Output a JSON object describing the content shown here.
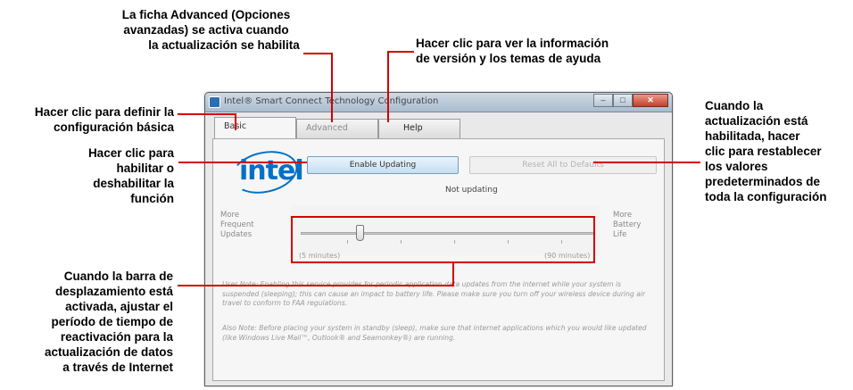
{
  "annotations": {
    "advanced_tab": [
      "La ficha Advanced (Opciones",
      "avanzadas) se activa cuando",
      "la actualización se habilita"
    ],
    "help_tab": [
      "Hacer clic para ver la información",
      "de versión y los temas de ayuda"
    ],
    "basic_tab": [
      "Hacer clic para definir la",
      "configuración básica"
    ],
    "enable_button": [
      "Hacer clic para",
      "habilitar o",
      "deshabilitar la",
      "función"
    ],
    "reset_button": [
      "Cuando la",
      "actualización está",
      "habilitada, hacer",
      "clic para restablecer",
      "los valores",
      "predeterminados de",
      "toda la configuración"
    ],
    "slider": [
      "Cuando la barra de",
      "desplazamiento está",
      "activada, ajustar el",
      "período de tiempo de",
      "reactivación para la",
      "actualización de datos",
      "a través de Internet"
    ]
  },
  "window": {
    "title": "Intel® Smart Connect Technology Configuration",
    "buttons": {
      "minimize": "–",
      "maximize": "□",
      "close": "✕"
    }
  },
  "tabs": [
    {
      "label": "Basic",
      "state": "active"
    },
    {
      "label": "Advanced",
      "state": "disabled"
    },
    {
      "label": "Help",
      "state": "normal"
    }
  ],
  "logo": {
    "text": "intel",
    "color": "#0071c5"
  },
  "buttons": {
    "enable": "Enable Updating",
    "reset": "Reset All to Defaults"
  },
  "status": "Not updating",
  "slider": {
    "left_label": [
      "More",
      "Frequent",
      "Updates"
    ],
    "right_label": [
      "More",
      "Battery",
      "Life"
    ],
    "min_label": "(5 minutes)",
    "max_label": "(90 minutes)",
    "value_fraction": 0.2
  },
  "notes": {
    "note1": "User Note: Enabling this service provides for periodic application data updates from the internet while your system is suspended (sleeping); this can cause an impact to battery life. Please make sure you turn off your wireless device during air travel to conform to FAA regulations.",
    "note2": "Also Note: Before placing your system in standby (sleep), make sure that internet applications which you would like updated (like Windows Live Mail™, Outlook® and Seamonkey®) are running."
  },
  "colors": {
    "annotation_line": "#d40000",
    "intel_blue": "#0071c5"
  }
}
